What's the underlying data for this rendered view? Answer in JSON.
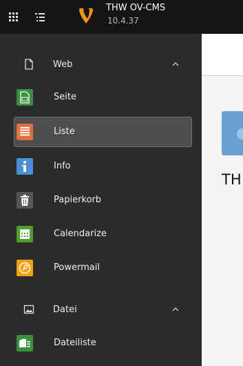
{
  "topbar": {
    "app_name": "THW OV-CMS",
    "version": "10.4.37",
    "grid_icon": "app-grid-icon",
    "list_icon": "page-tree-toggle-icon",
    "logo": "typo3-logo"
  },
  "sidebar": {
    "groups": [
      {
        "label": "Web",
        "icon": "document-icon",
        "expanded": true,
        "modules": [
          {
            "label": "Seite",
            "icon": "page-module-icon",
            "color": "#3a8e3f"
          },
          {
            "label": "Liste",
            "icon": "list-module-icon",
            "color": "#e0703c",
            "active": true
          },
          {
            "label": "Info",
            "icon": "info-icon",
            "color": "#4a90d9"
          },
          {
            "label": "Papierkorb",
            "icon": "trash-icon",
            "color": "#555555"
          },
          {
            "label": "Calendarize",
            "icon": "calendar-icon",
            "color": "#4f9e2e"
          },
          {
            "label": "Powermail",
            "icon": "powermail-icon",
            "color": "#f5a00b"
          }
        ]
      },
      {
        "label": "Datei",
        "icon": "image-icon",
        "expanded": true,
        "modules": [
          {
            "label": "Dateiliste",
            "icon": "filelist-icon",
            "color": "#3a8e3f"
          }
        ]
      }
    ]
  },
  "content": {
    "visible_text": "TH"
  }
}
